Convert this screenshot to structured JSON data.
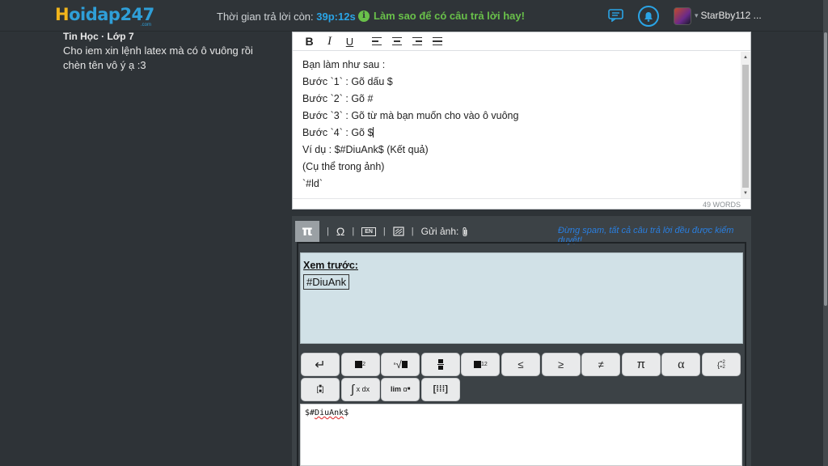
{
  "header": {
    "logo_h": "H",
    "logo_rest": "oidap247",
    "logo_sub": ".com",
    "timer_label": "Thời gian trả lời còn:",
    "timer_value": "39p:12s",
    "tip": "Làm sao để có câu trả lời hay!",
    "user_name": "StarBby112 ..."
  },
  "question": {
    "subject": "Tin Học · Lớp 7",
    "text": "Cho iem xin lệnh latex mà có ô vuông rồi chèn tên vô ý ạ :3"
  },
  "editor": {
    "toolbar": {
      "bold": "B",
      "italic": "I",
      "underline": "U"
    },
    "lines": [
      "Bạn làm như sau :",
      "Bước `1` : Gõ dấu $",
      "Bước `2` : Gõ #",
      "Bước `3` : Gõ từ mà bạn muốn cho vào ô vuông",
      "Bước `4` : Gõ $",
      "Ví dụ : $#DiuAnk$ (Kết quả)",
      "(Cụ thể trong ảnh)",
      "`#ld`"
    ],
    "word_count": "49 WORDS"
  },
  "math_panel": {
    "tabs": {
      "pi": "π",
      "omega": "Ω",
      "en": "EN"
    },
    "upload_label": "Gửi ảnh:",
    "warning": "Đừng spam, tất cả câu trả lời đều được kiểm duyệt!",
    "preview_label": "Xem trước:",
    "preview_value": "#DiuAnk",
    "buttons_row1": [
      "↵",
      "x²",
      "ⁿ√",
      "frac",
      "x₁₂",
      "≤",
      "≥",
      "≠",
      "π",
      "α",
      "cases"
    ],
    "buttons_row2": [
      "matrix-bracket",
      "∫ x dx",
      "lim α",
      "[:::]"
    ],
    "math_input_prefix": "$#",
    "math_input_word": "DiuAnk",
    "math_input_suffix": "$"
  },
  "colors": {
    "accent_blue": "#2aa4e6",
    "tip_green": "#69c04a",
    "logo_yellow": "#f2b51b",
    "preview_bg": "#d1e1e7",
    "warning_blue": "#2a7fe0"
  }
}
